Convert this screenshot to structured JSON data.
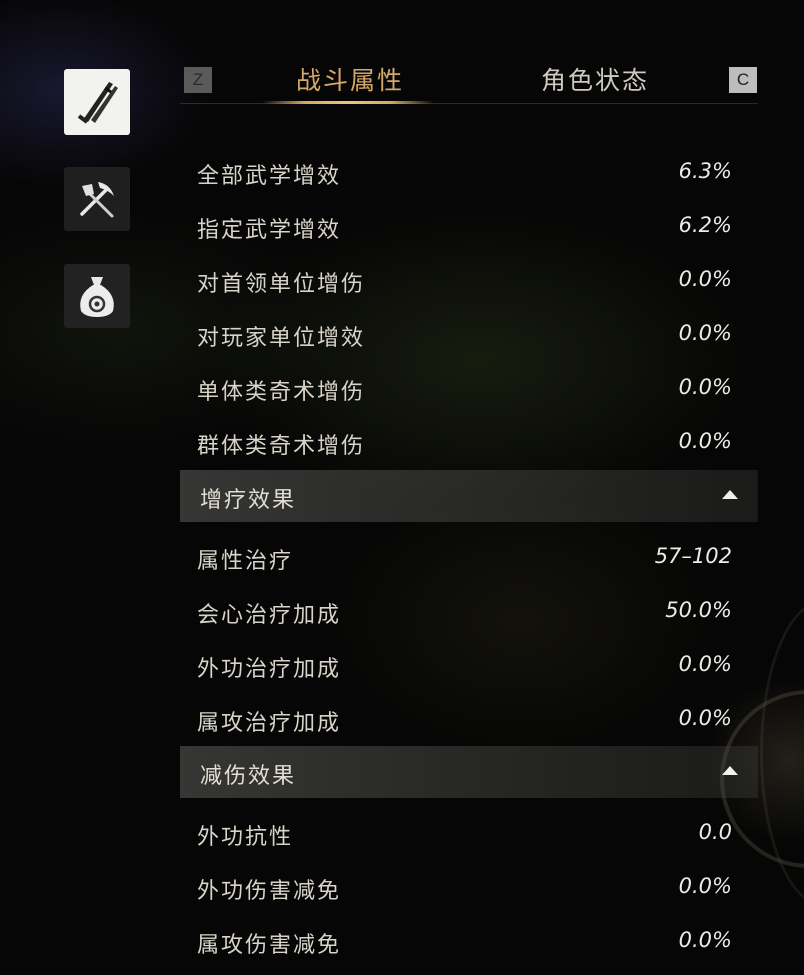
{
  "side_icons": [
    {
      "name": "weapon-icon",
      "active": true
    },
    {
      "name": "tools-icon",
      "active": false
    },
    {
      "name": "money-bag-icon",
      "active": false
    }
  ],
  "tabs": {
    "prev_key": "Z",
    "next_key": "C",
    "items": [
      {
        "label": "战斗属性",
        "active": true
      },
      {
        "label": "角色状态",
        "active": false
      }
    ]
  },
  "stats_top": [
    {
      "label": "全部武学增效",
      "value": "6.3%"
    },
    {
      "label": "指定武学增效",
      "value": "6.2%"
    },
    {
      "label": "对首领单位增伤",
      "value": "0.0%"
    },
    {
      "label": "对玩家单位增效",
      "value": "0.0%"
    },
    {
      "label": "单体类奇术增伤",
      "value": "0.0%"
    },
    {
      "label": "群体类奇术增伤",
      "value": "0.0%"
    }
  ],
  "section_heal": {
    "title": "增疗效果",
    "rows": [
      {
        "label": "属性治疗",
        "value": "57–102"
      },
      {
        "label": "会心治疗加成",
        "value": "50.0%"
      },
      {
        "label": "外功治疗加成",
        "value": "0.0%"
      },
      {
        "label": "属攻治疗加成",
        "value": "0.0%"
      }
    ]
  },
  "section_reduce": {
    "title": "减伤效果",
    "rows": [
      {
        "label": "外功抗性",
        "value": "0.0"
      },
      {
        "label": "外功伤害减免",
        "value": "0.0%"
      },
      {
        "label": "属攻伤害减免",
        "value": "0.0%"
      }
    ]
  },
  "colors": {
    "accent_gold": "#d4a866",
    "text": "#d8d4ca"
  }
}
